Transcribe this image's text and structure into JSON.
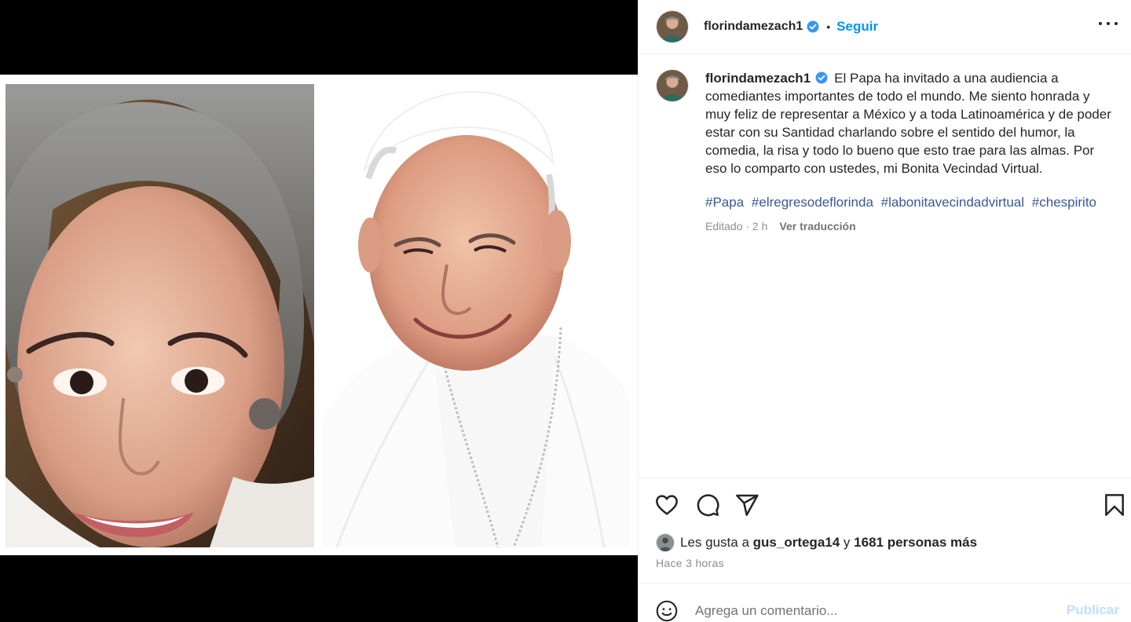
{
  "post": {
    "username": "florindamezach1",
    "follow_label": "Seguir",
    "separator": "•",
    "caption": "El Papa ha invitado a una audiencia a comediantes importantes de todo el mundo. Me siento honrada y muy feliz de representar a México y a toda Latinoamérica y de poder estar con su Santidad charlando sobre el sentido del humor, la comedia, la risa y todo lo bueno que esto trae para las almas. Por eso lo comparto con ustedes, mi Bonita Vecindad Virtual.",
    "hashtags": [
      "#Papa",
      "#elregresodeflorinda",
      "#labonitavecindadvirtual",
      "#chespirito"
    ],
    "edited_label": "Editado · 2 h",
    "translate_label": "Ver traducción",
    "likes": {
      "prefix": "Les gusta a",
      "user": "gus_ortega14",
      "conjunction": "y",
      "others": "1681 personas más"
    },
    "time_ago": "Hace 3 horas",
    "comment_placeholder": "Agrega un comentario...",
    "publish_label": "Publicar"
  },
  "colors": {
    "accent": "#0095f6",
    "hashtag": "#385898",
    "publish_disabled": "#c0dffd",
    "muted": "#8e8e8e",
    "verified": "#3897f0"
  },
  "icons": [
    "verified-badge-icon",
    "more-options-icon",
    "heart-icon",
    "comment-icon",
    "share-icon",
    "bookmark-icon",
    "emoji-icon"
  ]
}
